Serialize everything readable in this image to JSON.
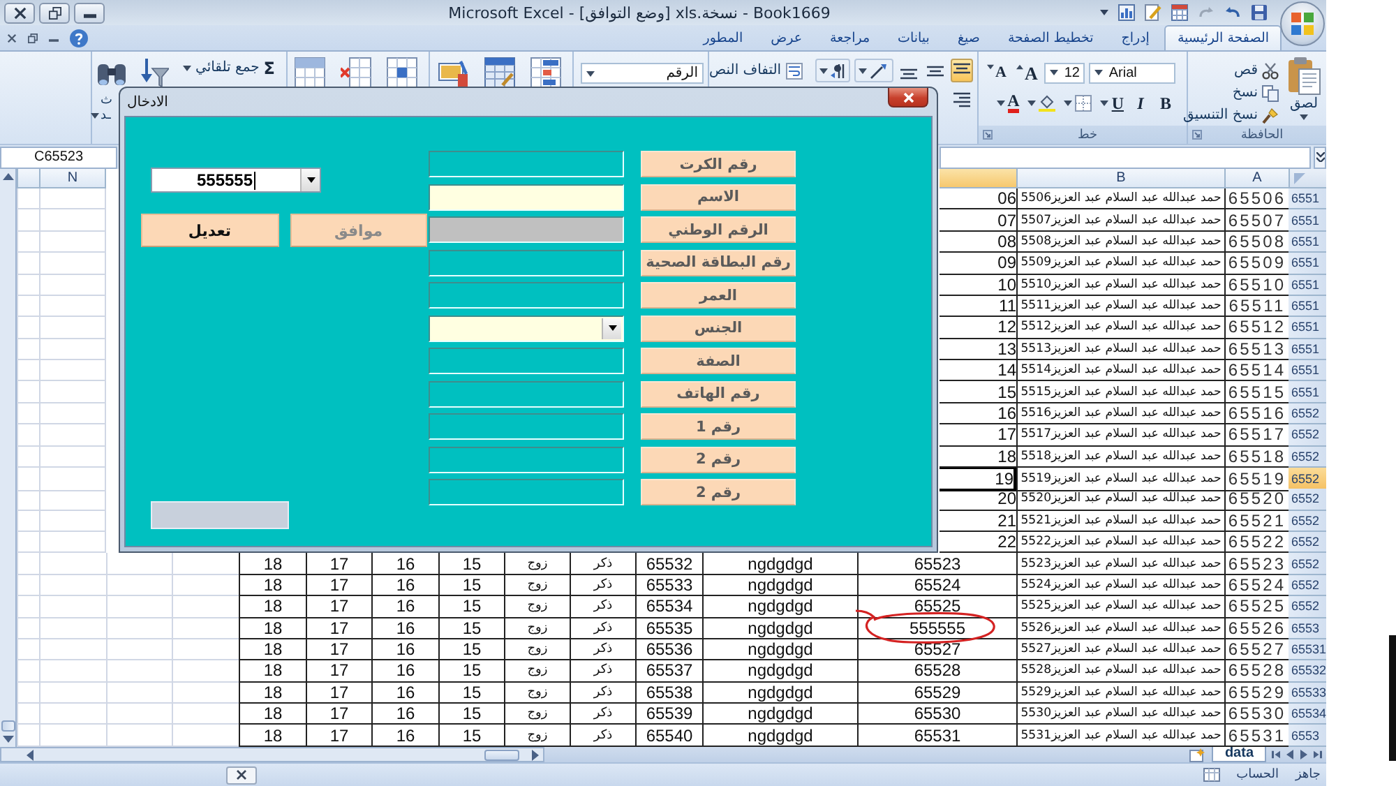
{
  "title_bar": {
    "title": "Book1669 - نسخة.xls  [وضع التوافق] - Microsoft Excel"
  },
  "ribbon_tabs": [
    {
      "label": "الصفحة الرئيسية",
      "selected": true
    },
    {
      "label": "إدراج",
      "selected": false
    },
    {
      "label": "تخطيط الصفحة",
      "selected": false
    },
    {
      "label": "صيغ",
      "selected": false
    },
    {
      "label": "بيانات",
      "selected": false
    },
    {
      "label": "مراجعة",
      "selected": false
    },
    {
      "label": "عرض",
      "selected": false
    },
    {
      "label": "المطور",
      "selected": false
    }
  ],
  "ribbon": {
    "clipboard": {
      "paste": "لصق",
      "cut": "قص",
      "copy": "نسخ",
      "format_painter": "نسخ التنسيق",
      "group_label": "الحافظة"
    },
    "font": {
      "font_name": "Arial",
      "font_size": "12",
      "grow": "A",
      "shrink": "A",
      "bold": "B",
      "italic": "I",
      "underline": "U",
      "font_color": "A",
      "group_label": "خط"
    },
    "alignment": {
      "vertical": [
        {
          "selected": true
        },
        {
          "selected": false
        },
        {
          "selected": false
        }
      ],
      "wrap_text": "التفاف النص"
    },
    "number": {
      "format": "الرقم"
    },
    "editing": {
      "autosum_sign": "Σ",
      "autosum": "جمع تلقائي",
      "find_fragments": [
        "ث",
        "ـد"
      ]
    }
  },
  "formula_bar": {
    "name_box": "C65523"
  },
  "sheet": {
    "column_headers": {
      "right": [
        {
          "label": "A",
          "selected": false
        },
        {
          "label": "B",
          "selected": false
        },
        {
          "selected": true
        }
      ],
      "left": [
        {
          "label": "N",
          "selected": false
        }
      ]
    },
    "rows": [
      {
        "header": "6551",
        "selected": false,
        "circled": false,
        "kind": "covered",
        "cells": [
          "65506",
          "حمد عبدالله عبد السلام عبد العزيز5506",
          "06"
        ]
      },
      {
        "header": "6551",
        "selected": false,
        "circled": false,
        "kind": "covered",
        "cells": [
          "65507",
          "حمد عبدالله عبد السلام عبد العزيز5507",
          "07"
        ]
      },
      {
        "header": "6551",
        "selected": false,
        "circled": false,
        "kind": "covered",
        "cells": [
          "65508",
          "حمد عبدالله عبد السلام عبد العزيز5508",
          "08"
        ]
      },
      {
        "header": "6551",
        "selected": false,
        "circled": false,
        "kind": "covered",
        "cells": [
          "65509",
          "حمد عبدالله عبد السلام عبد العزيز5509",
          "09"
        ]
      },
      {
        "header": "6551",
        "selected": false,
        "circled": false,
        "kind": "covered",
        "cells": [
          "65510",
          "حمد عبدالله عبد السلام عبد العزيز5510",
          "10"
        ]
      },
      {
        "header": "6551",
        "selected": false,
        "circled": false,
        "kind": "covered",
        "cells": [
          "65511",
          "حمد عبدالله عبد السلام عبد العزيز5511",
          "11"
        ]
      },
      {
        "header": "6551",
        "selected": false,
        "circled": false,
        "kind": "covered",
        "cells": [
          "65512",
          "حمد عبدالله عبد السلام عبد العزيز5512",
          "12"
        ]
      },
      {
        "header": "6551",
        "selected": false,
        "circled": false,
        "kind": "covered",
        "cells": [
          "65513",
          "حمد عبدالله عبد السلام عبد العزيز5513",
          "13"
        ]
      },
      {
        "header": "6551",
        "selected": false,
        "circled": false,
        "kind": "covered",
        "cells": [
          "65514",
          "حمد عبدالله عبد السلام عبد العزيز5514",
          "14"
        ]
      },
      {
        "header": "6551",
        "selected": false,
        "circled": false,
        "kind": "covered",
        "cells": [
          "65515",
          "حمد عبدالله عبد السلام عبد العزيز5515",
          "15"
        ]
      },
      {
        "header": "6552",
        "selected": false,
        "circled": false,
        "kind": "covered",
        "cells": [
          "65516",
          "حمد عبدالله عبد السلام عبد العزيز5516",
          "16"
        ]
      },
      {
        "header": "6552",
        "selected": false,
        "circled": false,
        "kind": "covered",
        "cells": [
          "65517",
          "حمد عبدالله عبد السلام عبد العزيز5517",
          "17"
        ]
      },
      {
        "header": "6552",
        "selected": false,
        "circled": false,
        "kind": "covered",
        "cells": [
          "65518",
          "حمد عبدالله عبد السلام عبد العزيز5518",
          "18"
        ]
      },
      {
        "header": "6552",
        "selected": true,
        "circled": false,
        "kind": "covered",
        "cells": [
          "65519",
          "حمد عبدالله عبد السلام عبد العزيز5519",
          "19"
        ]
      },
      {
        "header": "6552",
        "selected": false,
        "circled": false,
        "kind": "covered",
        "cells": [
          "65520",
          "حمد عبدالله عبد السلام عبد العزيز5520",
          "20"
        ]
      },
      {
        "header": "6552",
        "selected": false,
        "circled": false,
        "kind": "covered",
        "cells": [
          "65521",
          "حمد عبدالله عبد السلام عبد العزيز5521",
          "21"
        ]
      },
      {
        "header": "6552",
        "selected": false,
        "circled": false,
        "kind": "covered",
        "cells": [
          "65522",
          "حمد عبدالله عبد السلام عبد العزيز5522",
          "22"
        ]
      },
      {
        "header": "6552",
        "selected": false,
        "circled": false,
        "kind": "full",
        "cells": [
          "65523",
          "حمد عبدالله عبد السلام عبد العزيز5523",
          "65523",
          "ngdgdgd",
          "65532",
          "ذكر",
          "زوج",
          "15",
          "16",
          "17",
          "18"
        ]
      },
      {
        "header": "6552",
        "selected": false,
        "circled": false,
        "kind": "full",
        "cells": [
          "65524",
          "حمد عبدالله عبد السلام عبد العزيز5524",
          "65524",
          "ngdgdgd",
          "65533",
          "ذكر",
          "زوج",
          "15",
          "16",
          "17",
          "18"
        ]
      },
      {
        "header": "6552",
        "selected": false,
        "circled": false,
        "kind": "full",
        "cells": [
          "65525",
          "حمد عبدالله عبد السلام عبد العزيز5525",
          "65525",
          "ngdgdgd",
          "65534",
          "ذكر",
          "زوج",
          "15",
          "16",
          "17",
          "18"
        ]
      },
      {
        "header": "6553",
        "selected": false,
        "circled": true,
        "kind": "full",
        "cells": [
          "65526",
          "حمد عبدالله عبد السلام عبد العزيز5526",
          "555555",
          "ngdgdgd",
          "65535",
          "ذكر",
          "زوج",
          "15",
          "16",
          "17",
          "18"
        ]
      },
      {
        "header": "65531",
        "selected": false,
        "circled": false,
        "kind": "full",
        "cells": [
          "65527",
          "حمد عبدالله عبد السلام عبد العزيز5527",
          "65527",
          "ngdgdgd",
          "65536",
          "ذكر",
          "زوج",
          "15",
          "16",
          "17",
          "18"
        ]
      },
      {
        "header": "65532",
        "selected": false,
        "circled": false,
        "kind": "full",
        "cells": [
          "65528",
          "حمد عبدالله عبد السلام عبد العزيز5528",
          "65528",
          "ngdgdgd",
          "65537",
          "ذكر",
          "زوج",
          "15",
          "16",
          "17",
          "18"
        ]
      },
      {
        "header": "65533",
        "selected": false,
        "circled": false,
        "kind": "full",
        "cells": [
          "65529",
          "حمد عبدالله عبد السلام عبد العزيز5529",
          "65529",
          "ngdgdgd",
          "65538",
          "ذكر",
          "زوج",
          "15",
          "16",
          "17",
          "18"
        ]
      },
      {
        "header": "65534",
        "selected": false,
        "circled": false,
        "kind": "full",
        "cells": [
          "65530",
          "حمد عبدالله عبد السلام عبد العزيز5530",
          "65530",
          "ngdgdgd",
          "65539",
          "ذكر",
          "زوج",
          "15",
          "16",
          "17",
          "18"
        ]
      },
      {
        "header": "6553",
        "selected": false,
        "circled": false,
        "kind": "full",
        "cells": [
          "65531",
          "حمد عبدالله عبد السلام عبد العزيز5531",
          "65531",
          "ngdgdgd",
          "65540",
          "ذكر",
          "زوج",
          "15",
          "16",
          "17",
          "18"
        ]
      }
    ]
  },
  "sheet_tabs": [
    {
      "label": "data",
      "selected": true
    }
  ],
  "status_bar": {
    "items": [
      "جاهز",
      "الحساب"
    ]
  },
  "dialog": {
    "title": "الادخال",
    "record_combo": {
      "value": "555555",
      "focused": true
    },
    "buttons": [
      {
        "label": "موافق",
        "disabled": true
      },
      {
        "label": "تعديل",
        "disabled": false
      }
    ],
    "fields": [
      {
        "label": "رقم الكرت",
        "kind": "text",
        "color": "#00c0c0"
      },
      {
        "label": "الاسم",
        "kind": "text",
        "color": "#ffffe1"
      },
      {
        "label": "الرقم الوطني",
        "kind": "text",
        "color": "#c0c0c0"
      },
      {
        "label": "رقم البطاقة الصحية",
        "kind": "text",
        "color": "#00c0c0"
      },
      {
        "label": "العمر",
        "kind": "text",
        "color": "#00c0c0"
      },
      {
        "label": "الجنس",
        "kind": "combo",
        "color": "#ffffe1"
      },
      {
        "label": "الصفة",
        "kind": "text",
        "color": "#00c0c0"
      },
      {
        "label": "رقم الهاتف",
        "kind": "text",
        "color": "#00c0c0"
      },
      {
        "label": "رقم 1",
        "kind": "text",
        "color": "#00c0c0"
      },
      {
        "label": "رقم 2",
        "kind": "text",
        "color": "#00c0c0"
      },
      {
        "label": "رقم 2",
        "kind": "text",
        "color": "#00c0c0"
      }
    ]
  }
}
